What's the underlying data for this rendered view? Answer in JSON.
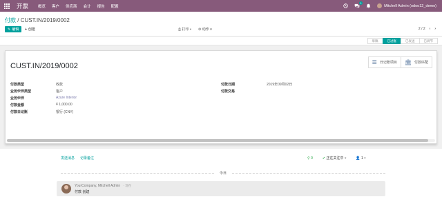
{
  "topbar": {
    "app_title": "开票",
    "menu": [
      "概览",
      "客户",
      "供应商",
      "会计",
      "报告",
      "配置"
    ],
    "messages_badge": "1",
    "user_name": "Mitchell Admin (odoo12_demo)"
  },
  "breadcrumb": {
    "parent": "付款",
    "separator": "/",
    "current": "CUST.IN/2019/0002"
  },
  "toolbar": {
    "edit_label": "编辑",
    "create_label": "创建",
    "print_label": "打印",
    "action_label": "动作",
    "pager": "2 / 2"
  },
  "status_steps": [
    "草稿",
    "已过账",
    "已发送",
    "已调节"
  ],
  "active_step_index": 1,
  "record": {
    "title": "CUST.IN/2019/0002",
    "smart_buttons": [
      {
        "label": "日记账项目",
        "icon": "list-icon"
      },
      {
        "label": "付款匹配",
        "icon": "bank-icon"
      }
    ],
    "left_fields": [
      {
        "label": "付款类型",
        "value": "收款",
        "is_link": false
      },
      {
        "label": "业务伙伴类型",
        "value": "客户",
        "is_link": false
      },
      {
        "label": "业务伙伴",
        "value": "Azure Interior",
        "is_link": true
      },
      {
        "label": "付款金额",
        "value": "¥ 1,000.00",
        "is_link": false
      },
      {
        "label": "付款日记账",
        "value": "银行 (CNY)",
        "is_link": false
      }
    ],
    "right_fields": [
      {
        "label": "付款日期",
        "value": "2019年09月02日"
      },
      {
        "label": "付款交易",
        "value": ""
      }
    ]
  },
  "chatter": {
    "send_message": "发送消息",
    "log_note": "记录备注",
    "attachments_count": "0",
    "following_label": "正在关注中",
    "followers_count": "1",
    "today_label": "今日",
    "message": {
      "author": "YourCompany, Mitchell Admin",
      "time": "- 现在",
      "body": "付款 创建"
    }
  }
}
